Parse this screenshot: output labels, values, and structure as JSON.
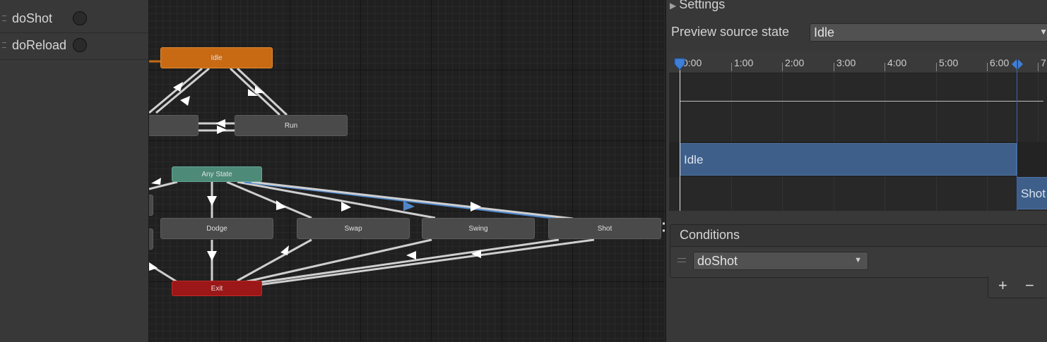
{
  "parameters": [
    {
      "name": "doShot"
    },
    {
      "name": "doReload"
    }
  ],
  "states": {
    "idle": "Idle",
    "walk": "",
    "run": "Run",
    "any_state": "Any State",
    "dodge": "Dodge",
    "swap": "Swap",
    "swing": "Swing",
    "shot": "Shot",
    "exit": "Exit"
  },
  "inspector": {
    "settings_label": "Settings",
    "preview_source_label": "Preview source state",
    "preview_source_value": "Idle",
    "timeline_ticks": [
      "0:00",
      "1:00",
      "2:00",
      "3:00",
      "4:00",
      "5:00",
      "6:00",
      "7"
    ],
    "clip_from": "Idle",
    "clip_to": "Shot",
    "conditions_label": "Conditions",
    "condition_value": "doShot",
    "plus": "+",
    "minus": "−"
  },
  "colors": {
    "idle_node": "#c86a14",
    "any_state_node": "#4d8a78",
    "exit_node": "#9c1717",
    "selected_transition": "#4f86c9"
  }
}
